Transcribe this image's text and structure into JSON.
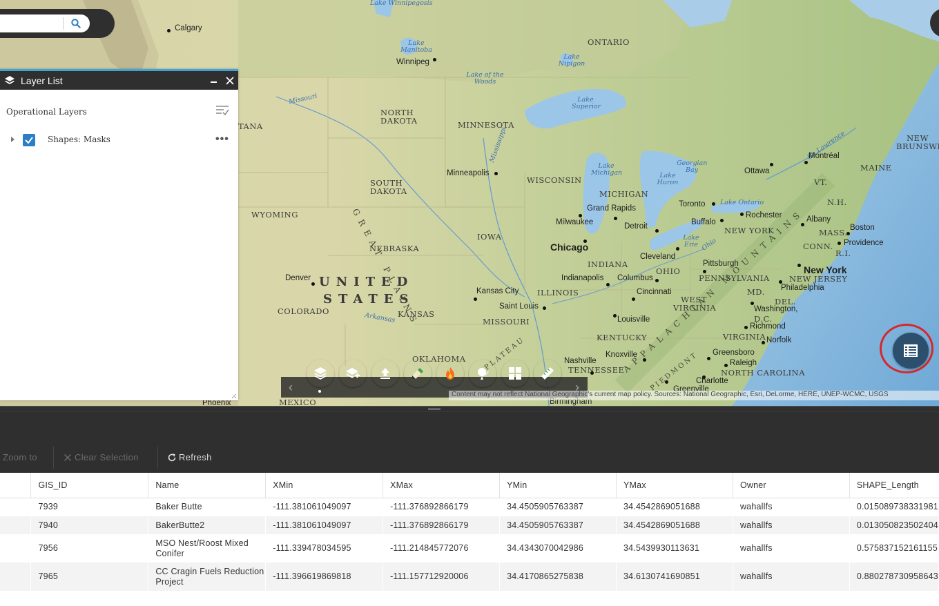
{
  "search": {
    "placeholder": ""
  },
  "layer_list": {
    "title": "Layer List",
    "section_title": "Operational Layers",
    "layers": [
      {
        "name": "Shapes: Masks",
        "checked": true
      }
    ]
  },
  "map": {
    "countries": [
      "UNITED",
      "STATES"
    ],
    "regions": [
      "GREAT PLAINS",
      "APPALACHIAN MOUNTAINS",
      "PLATEAU",
      "PIEDMONT"
    ],
    "states": [
      "ONTARIO",
      "NORTH DAKOTA",
      "SOUTH DAKOTA",
      "MINNESOTA",
      "WISCONSIN",
      "MICHIGAN",
      "IOWA",
      "NEBRASKA",
      "WYOMING",
      "COLORADO",
      "KANSAS",
      "MISSOURI",
      "ILLINOIS",
      "INDIANA",
      "OHIO",
      "PENNSYLVANIA",
      "NEW YORK",
      "KENTUCKY",
      "TENNESSEE",
      "OKLAHOMA",
      "WEST VIRGINIA",
      "VIRGINIA",
      "NORTH CAROLINA",
      "NEW JERSEY",
      "MAINE",
      "NEW BRUNSWICK",
      "VT.",
      "N.H.",
      "MASS.",
      "CONN.",
      "R.I.",
      "MD.",
      "DEL.",
      "D.C.",
      "MEXICO",
      "TANA"
    ],
    "cities": [
      "Calgary",
      "Winnipeg",
      "Minneapolis",
      "Milwaukee",
      "Grand Rapids",
      "Detroit",
      "Chicago",
      "Toronto",
      "Buffalo",
      "Rochester",
      "Ottawa",
      "Montréal",
      "Albany",
      "Boston",
      "Providence",
      "New York",
      "Philadelphia",
      "Washington,",
      "Richmond",
      "Norfolk",
      "Pittsburgh",
      "Cleveland",
      "Columbus",
      "Indianapolis",
      "Cincinnati",
      "Louisville",
      "Kansas City",
      "Saint Louis",
      "Denver",
      "Nashville",
      "Knoxville",
      "Greensboro",
      "Raleigh",
      "Charlotte",
      "Greenville",
      "Birmingham",
      "Phoenix"
    ],
    "water": [
      "Lake Winnipegosis",
      "Lake Manitoba",
      "Lake of the Woods",
      "Lake Nipigon",
      "Lake Superior",
      "Lake Michigan",
      "Lake Huron",
      "Georgian Bay",
      "Lake Erie",
      "Lake Ontario",
      "Missouri",
      "Mississippi",
      "Arkansas",
      "Ohio",
      "St. Lawrence"
    ],
    "attribution": "Content may not reflect National Geographic's current map policy. Sources: National Geographic, Esri, DeLorme, HERE, UNEP-WCMC, USGS"
  },
  "dock": {
    "widgets": [
      {
        "name": "layer-list",
        "color": "#1a9ddb"
      },
      {
        "name": "add-data",
        "color": "#2a9a46"
      },
      {
        "name": "upload",
        "color": "#e5641e"
      },
      {
        "name": "draw",
        "color": "#8a6a4a"
      },
      {
        "name": "fire",
        "color": "#6a6a6a"
      },
      {
        "name": "markup",
        "color": "#59b8c5"
      },
      {
        "name": "basemap",
        "color": "#1a9ddb"
      },
      {
        "name": "measure",
        "color": "#2a9a46"
      }
    ]
  },
  "toolbar": {
    "zoom_to": "Zoom to",
    "clear_selection": "Clear Selection",
    "refresh": "Refresh"
  },
  "table": {
    "columns": [
      "GIS_ID",
      "Name",
      "XMin",
      "XMax",
      "YMin",
      "YMax",
      "Owner",
      "SHAPE_Length"
    ],
    "rows": [
      [
        "7939",
        "Baker Butte",
        "-111.381061049097",
        "-111.376892866179",
        "34.4505905763387",
        "34.4542869051688",
        "wahallfs",
        "0.015089738331981"
      ],
      [
        "7940",
        "BakerButte2",
        "-111.381061049097",
        "-111.376892866179",
        "34.4505905763387",
        "34.4542869051688",
        "wahallfs",
        "0.013050823502404"
      ],
      [
        "7956",
        "MSO Nest/Roost Mixed Conifer",
        "-111.339478034595",
        "-111.214845772076",
        "34.4343070042986",
        "34.5439930113631",
        "wahallfs",
        "0.575837152161155"
      ],
      [
        "7965",
        "CC Cragin Fuels Reduction Project",
        "-111.396619869818",
        "-111.157712920006",
        "34.4170865275838",
        "34.6130741690851",
        "wahallfs",
        "0.880278730958643"
      ]
    ]
  }
}
